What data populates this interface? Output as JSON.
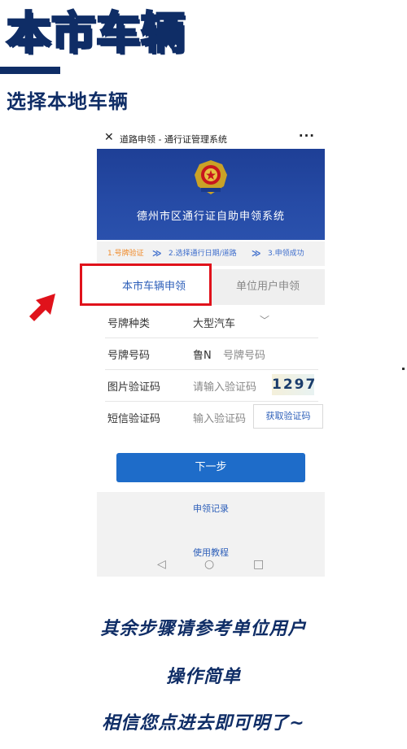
{
  "header": {
    "title": "本市车辆",
    "subtitle": "选择本地车辆"
  },
  "phone": {
    "titlebar": {
      "close_icon": "close-icon",
      "title": "道路申领 - 通行证管理系统",
      "more": "···"
    },
    "banner": {
      "title": "德州市区通行证自助申领系统"
    },
    "steps": [
      {
        "label": "1.号牌验证",
        "state": "current"
      },
      {
        "label": "2.选择通行日期/道路",
        "state": "pending"
      },
      {
        "label": "3.申领成功",
        "state": "pending"
      }
    ],
    "step_separator": "≫",
    "tabs": [
      {
        "label": "本市车辆申领",
        "active": true
      },
      {
        "label": "单位用户申领",
        "active": false
      }
    ],
    "form": {
      "plate_type": {
        "label": "号牌种类",
        "value": "大型汽车"
      },
      "plate_number": {
        "label": "号牌号码",
        "prefix": "鲁N",
        "placeholder": "号牌号码"
      },
      "image_code": {
        "label": "图片验证码",
        "placeholder": "请输入验证码",
        "captcha": "1297"
      },
      "sms_code": {
        "label": "短信验证码",
        "placeholder": "输入验证码",
        "button": "获取验证码"
      }
    },
    "next_button": "下一步",
    "links": {
      "records": "申领记录",
      "tutorial": "使用教程"
    },
    "navbar": {
      "back": "◁",
      "home": "○",
      "recent": "□"
    }
  },
  "annotations": {
    "highlight_color": "#e0121b",
    "arrow_color": "#e0121b"
  },
  "footer": {
    "line1": "其余步骤请参考单位用户",
    "line2": "操作简单",
    "line3": "相信您点进去即可明了~"
  },
  "colors": {
    "title_navy": "#0f2d66",
    "banner_blue": "#264ba6",
    "primary_button": "#1e6cc9",
    "step_active": "#f08b2a"
  }
}
